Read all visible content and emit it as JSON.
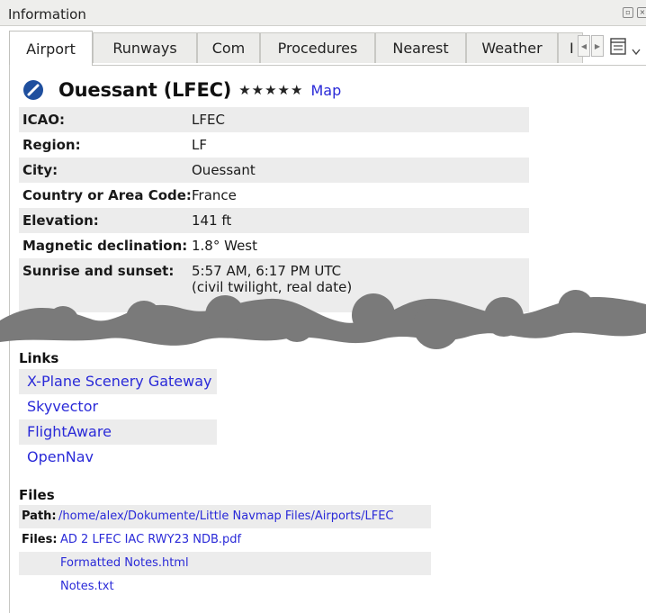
{
  "window": {
    "title": "Information"
  },
  "tabs": [
    {
      "label": "Airport",
      "active": true
    },
    {
      "label": "Runways",
      "active": false
    },
    {
      "label": "Com",
      "active": false
    },
    {
      "label": "Procedures",
      "active": false
    },
    {
      "label": "Nearest",
      "active": false
    },
    {
      "label": "Weather",
      "active": false
    },
    {
      "label": "I",
      "active": false
    }
  ],
  "airport": {
    "name": "Ouessant (LFEC)",
    "stars": "★★★★★",
    "map_link": "Map",
    "rows": [
      {
        "label": "ICAO:",
        "value": "LFEC"
      },
      {
        "label": "Region:",
        "value": "LF"
      },
      {
        "label": "City:",
        "value": "Ouessant"
      },
      {
        "label": "Country or Area Code:",
        "value": "France"
      },
      {
        "label": "Elevation:",
        "value": "141 ft"
      },
      {
        "label": "Magnetic declination:",
        "value": "1.8° West"
      },
      {
        "label": "Sunrise and sunset:",
        "value": "5:57 AM, 6:17 PM UTC",
        "value2": "(civil twilight, real date)"
      }
    ]
  },
  "links": {
    "title": "Links",
    "items": [
      "X-Plane Scenery Gateway",
      "Skyvector",
      "FlightAware",
      "OpenNav"
    ]
  },
  "files": {
    "title": "Files",
    "path_label": "Path:",
    "path_value": "/home/alex/Dokumente/Little Navmap Files/Airports/LFEC",
    "files_label": "Files:",
    "items": [
      "AD 2 LFEC IAC RWY23 NDB.pdf",
      "Formatted Notes.html",
      "Notes.txt"
    ]
  },
  "colors": {
    "link": "#2a2ad8",
    "shaded_row": "#ececec",
    "scribble": "#7a7a7a"
  }
}
